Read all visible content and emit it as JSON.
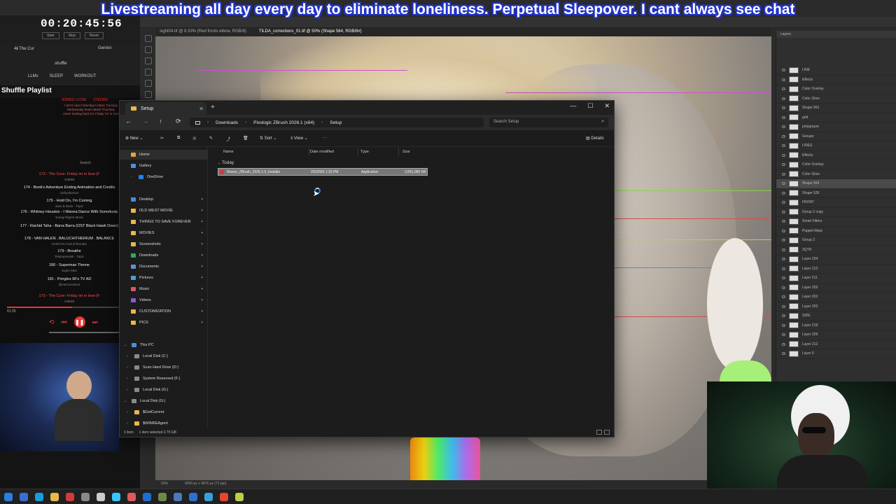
{
  "banner": {
    "text": "Livestreaming all day every day to eliminate loneliness. Perpetual Sleepover. I cant always see chat"
  },
  "timer": {
    "value": "00:20:45:56",
    "start": "Start",
    "stop": "Stop",
    "reset": "Reset"
  },
  "left_browser": {
    "tab": "4ℹ The Cur",
    "gemini": "Gemini",
    "tab2": "shuffle",
    "bookmarks": [
      "LLMs",
      "SLEEP",
      "WORKOUT"
    ]
  },
  "playlist": {
    "title": "Shuffle Playlist",
    "songs_love": "SONGS I LOVE",
    "count": "173/2253",
    "note": "I don't care if Monday's black Tuesday Wednesday heart attack Thursday never looking back It's Friday I'm in love",
    "search": "Search",
    "tracks": [
      {
        "title": "173 - The Cure- Friday im in love (F",
        "artist": "1066kit",
        "now": true
      },
      {
        "title": "174 - Bonk's Adventure Ending Animation and Credits",
        "artist": "carbyokemon",
        "now": false
      },
      {
        "title": "175 - Hold On, I'm Coming",
        "artist": "Sam & Dave - Topic",
        "now": false
      },
      {
        "title": "176 - Whitney Houston - I Wanna Dance With Somebody",
        "artist": "Young Pilgrim Music",
        "now": false
      },
      {
        "title": "177 - Rachid Taha - Barra Barra (OST Black Hawk Down)",
        "artist": "",
        "now": false
      },
      {
        "title": "178 - VAN HALEN . BALUCHITHERIUM . BALANCE",
        "artist": "SARCOS God of thunder",
        "now": false
      },
      {
        "title": "179 - Breathe",
        "artist": "Telepopmusik - Topic",
        "now": false
      },
      {
        "title": "180 - Superman Theme",
        "artist": "Super Man",
        "now": false
      },
      {
        "title": "181 - Pringles 90's TV AD",
        "artist": "@memorolume",
        "now": false
      },
      {
        "title": "173 - The Cure- Friday im in love (F",
        "artist": "1066kit",
        "now": true
      }
    ],
    "elapsed": "01:25",
    "progress": 0.58
  },
  "photoshop": {
    "tabs": [
      "sight04.tif @ 8.33% (Red fronts elbow, RGB/8)",
      "TILDA_corrections_01.tif @ 50% (Shape 564, RGB/8#)"
    ],
    "active_tab": 1,
    "status_zoom": "50%",
    "status_doc": "9000 px x 4876 px (72 ppi)",
    "layers_title": "Layers",
    "layer_rows": [
      "LINE",
      "Effects",
      "Color Overlay",
      "Color Glow",
      "Shape 563",
      "grid",
      "polygrayze",
      "Groupe",
      "LINES",
      "Effects",
      "Color Overlay",
      "Color Glow",
      "Shape 564",
      "Shape 528",
      "FRONT",
      "Group 2 copy",
      "Smart Filters",
      "Puppet Warp",
      "Group 2",
      "3QTR",
      "Layer 234",
      "Layer 213",
      "Layer 211",
      "Layer 209",
      "Layer 202",
      "Layer 203",
      "SIDE",
      "Layer 218",
      "Layer 228",
      "Layer 212",
      "Layer 0"
    ],
    "selected_layer": 12
  },
  "explorer": {
    "tab_title": "Setup",
    "breadcrumb": [
      "Downloads",
      "Pixologic ZBrush 2026.1 (x64)",
      "Setup"
    ],
    "search_placeholder": "Search Setup",
    "commands": {
      "new": "New",
      "sort": "Sort",
      "view": "View",
      "more": "···",
      "details": "Details"
    },
    "columns": [
      "Name",
      "Date modified",
      "Type",
      "Size"
    ],
    "group": "Today",
    "file": {
      "name": "Maxon_ZBrush_2026.1.0_Installer",
      "date": "2/5/2026 1:33 PM",
      "type": "Application",
      "size": "2,891,080 KB"
    },
    "nav": {
      "quick": [
        {
          "label": "Home",
          "color": "#e8a33d"
        },
        {
          "label": "Gallery",
          "color": "#4d8de0"
        },
        {
          "label": "OneDrive",
          "color": "#2a7fe0"
        }
      ],
      "pinned": [
        {
          "label": "Desktop",
          "color": "#3f8fd9"
        },
        {
          "label": "OLD WEST MOVIE",
          "color": "#e8b84a"
        },
        {
          "label": "THINGS TO SAVE FOREVER",
          "color": "#e8b84a"
        },
        {
          "label": "MOVIES",
          "color": "#e8b84a"
        },
        {
          "label": "Screenshots",
          "color": "#e8b84a"
        },
        {
          "label": "Downloads",
          "color": "#2fa86a"
        },
        {
          "label": "Documents",
          "color": "#6a8fc9"
        },
        {
          "label": "Pictures",
          "color": "#4aa0d9"
        },
        {
          "label": "Music",
          "color": "#d9546a"
        },
        {
          "label": "Videos",
          "color": "#8a5ad9"
        },
        {
          "label": "CUSTOMIZATION",
          "color": "#e8b84a"
        },
        {
          "label": "PICS",
          "color": "#e8b84a"
        }
      ],
      "this_pc": "This PC",
      "drives": [
        "Local Disk (C:)",
        "Scan Hard Drive (D:)",
        "System Reserved (F:)",
        "Local Disk (G:)"
      ],
      "local_disk_g": "Local Disk (G:)",
      "folders": [
        "$GetCurrent",
        "$WINREAgent"
      ]
    },
    "status": {
      "items": "1 item",
      "selected": "1 item selected  2.75 GB"
    }
  },
  "colors": {
    "banner_outline": "#2233cc",
    "accent": "#2a7fe0",
    "red": "#e33"
  }
}
